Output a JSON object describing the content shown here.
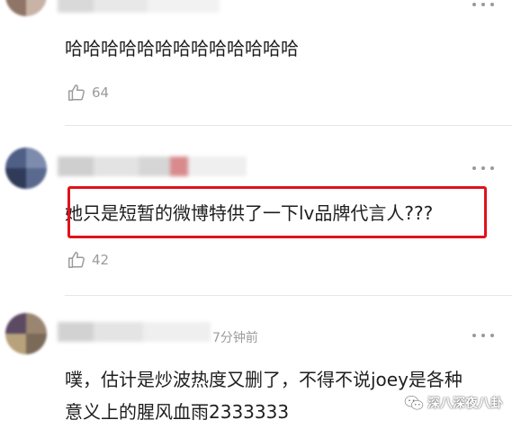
{
  "comments": [
    {
      "text": "哈哈哈哈哈哈哈哈哈哈哈哈哈",
      "likes": "64"
    },
    {
      "text": "她只是短暂的微博特供了一下lv品牌代言人???",
      "likes": "42"
    },
    {
      "time": "7分钟前",
      "text_line1": "噗，估计是炒波热度又删了，不得不说joey是各种",
      "text_line2": "意义上的腥风血雨2333333"
    }
  ],
  "watermark": {
    "text": "深八深夜八卦"
  },
  "colors": {
    "highlight_border": "#e0121b",
    "muted_text": "#9b9b9b",
    "divider": "#e6e6e6"
  },
  "icons": {
    "like": "thumbs-up-icon",
    "more": "more-dots-icon",
    "watermark": "wechat-logo-icon"
  }
}
